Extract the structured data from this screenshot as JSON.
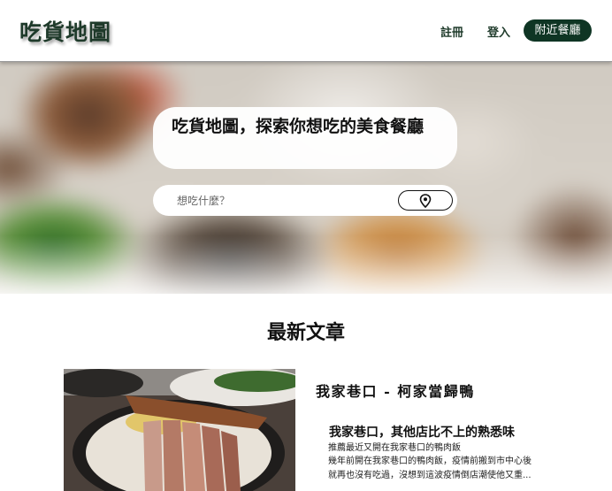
{
  "header": {
    "logo": "吃貨地圖",
    "nav": {
      "register": "註冊",
      "login": "登入",
      "attach_restaurant": "附近餐廳"
    }
  },
  "hero": {
    "title": "吃貨地圖，探索你想吃的美食餐廳",
    "search": {
      "placeholder": "想吃什麼？",
      "value": ""
    },
    "location_icon": "map-pin-icon"
  },
  "articles": {
    "section_title": "最新文章",
    "items": [
      {
        "title": "我家巷口 - 柯家當歸鴨",
        "headline": "我家巷口，其他店比不上的熟悉味",
        "excerpt_lines": [
          "推薦最近又開在我家巷口的鴨肉飯",
          "幾年前開在我家巷口的鴨肉飯，疫情前搬到市中心後",
          "就再也沒有吃過，沒想到這波疫情倒店潮使他又重..."
        ]
      }
    ]
  },
  "colors": {
    "brand_green": "#0f3524",
    "text_dark": "#111111"
  }
}
